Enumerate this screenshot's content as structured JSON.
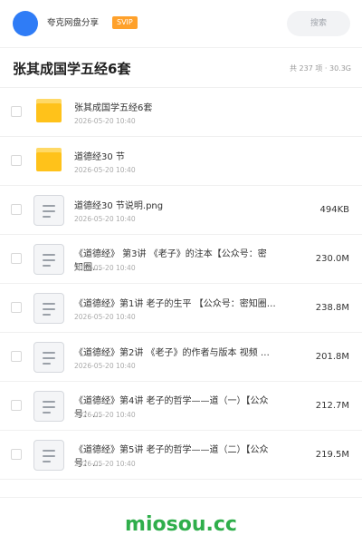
{
  "header": {
    "brand": "夸克网盘分享",
    "vip": "SVIP",
    "search_placeholder": "搜索",
    "avatar_color": "#2f7cf6",
    "vip_color": "#ffa12b"
  },
  "folder": {
    "title": "张其成国学五经6套",
    "stats": "共 237 项 · 30.3G"
  },
  "files": [
    {
      "type": "folder",
      "name": "张其成国学五经6套",
      "date": "2026-05-20 10:40",
      "size": ""
    },
    {
      "type": "folder",
      "name": "道德经30 节",
      "date": "2026-05-20 10:40",
      "size": ""
    },
    {
      "type": "file",
      "name": "道德经30 节说明.png",
      "date": "2026-05-20 10:40",
      "size": "494KB"
    },
    {
      "type": "file",
      "name": "《道德经》 第3讲 《老子》的注本【公众号：密知圈…",
      "date": "2026-05-20 10:40",
      "size": "230.0M"
    },
    {
      "type": "file",
      "name": "《道德经》第1讲 老子的生平 【公众号：密知圈…",
      "date": "2026-05-20 10:40",
      "size": "238.8M"
    },
    {
      "type": "file",
      "name": "《道德经》第2讲 《老子》的作者与版本 视频 …",
      "date": "2026-05-20 10:40",
      "size": "201.8M"
    },
    {
      "type": "file",
      "name": "《道德经》第4讲 老子的哲学——道（一）【公众号：…",
      "date": "2026-05-20 10:40",
      "size": "212.7M"
    },
    {
      "type": "file",
      "name": "《道德经》第5讲 老子的哲学——道（二）【公众号：…",
      "date": "2026-05-20 10:40",
      "size": "219.5M"
    }
  ],
  "watermark": "miosou.cc"
}
